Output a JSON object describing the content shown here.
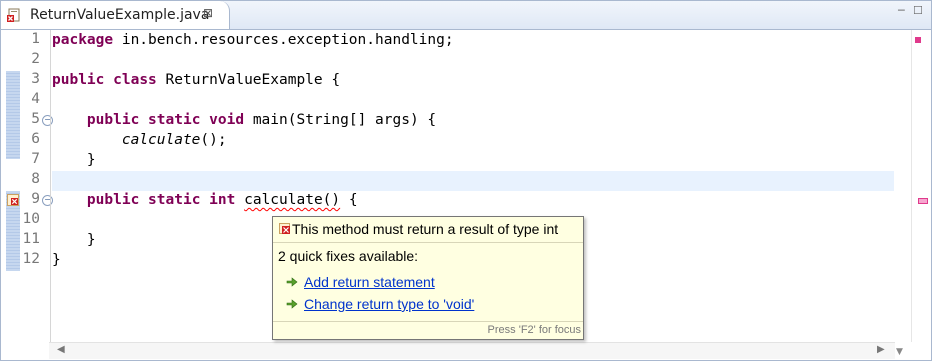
{
  "tab": {
    "title": "ReturnValueExample.java",
    "close_glyph": "⊠",
    "icon": "java-file-error-icon"
  },
  "window_controls": {
    "minimize": "─",
    "maximize": "☐"
  },
  "editor": {
    "line_numbers": [
      "1",
      "2",
      "3",
      "4",
      "5",
      "6",
      "7",
      "8",
      "9",
      "10",
      "11",
      "12"
    ],
    "current_line": 8,
    "error_line": 9,
    "lines": [
      "package in.bench.resources.exception.handling;",
      "",
      "public class ReturnValueExample {",
      "",
      "    public static void main(String[] args) {",
      "        calculate();",
      "    }",
      "",
      "    public static int calculate() {",
      "",
      "    }",
      "}"
    ],
    "line1_keyword": "package",
    "line1_rest": " in.bench.resources.exception.handling;",
    "line3_kw1": "public",
    "line3_kw2": "class",
    "line3_rest": " ReturnValueExample {",
    "line5_kw1": "public",
    "line5_kw2": "static",
    "line5_kw3": "void",
    "line5_rest": " main(String[] args) {",
    "line6_call": "calculate",
    "line6_rest": "();",
    "line7_text": "}",
    "line9_kw1": "public",
    "line9_kw2": "static",
    "line9_kw3": "int",
    "line9_error_token": "calculate()",
    "line9_rest": " {",
    "line11_text": "}",
    "line12_text": "}"
  },
  "popup": {
    "message": "This method must return a result of type int",
    "quick_fix_count": "2 quick fixes available:",
    "fixes": [
      {
        "label": "Add return statement",
        "icon": "quick-fix-icon"
      },
      {
        "label": "Change return type to 'void'",
        "icon": "quick-fix-icon"
      }
    ],
    "footer": "Press 'F2' for focus"
  },
  "colors": {
    "keyword": "#7f0055",
    "current_line": "#e8f2fe",
    "error_underline": "#ff0000",
    "popup_bg": "#ffffe1",
    "link": "#0033cc"
  }
}
